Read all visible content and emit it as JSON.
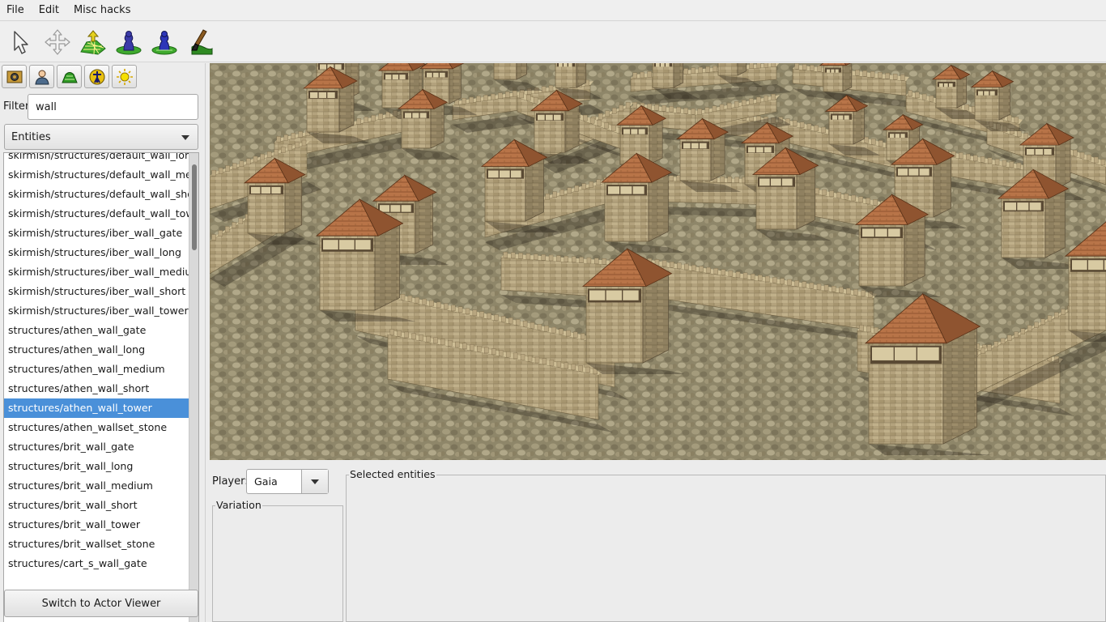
{
  "menu": {
    "items": [
      "File",
      "Edit",
      "Misc hacks"
    ]
  },
  "toolbar": {
    "tools": [
      {
        "icon": "select-arrow-icon"
      },
      {
        "icon": "move-cross-icon"
      },
      {
        "icon": "terrain-elevate-icon"
      },
      {
        "icon": "place-object-icon"
      },
      {
        "icon": "player-object-icon"
      },
      {
        "icon": "paint-brush-icon"
      }
    ]
  },
  "sections": {
    "buttons": [
      {
        "icon": "map-settings-icon"
      },
      {
        "icon": "player-settings-icon"
      },
      {
        "icon": "terrain-icon"
      },
      {
        "icon": "object-icon"
      },
      {
        "icon": "environment-sun-icon"
      }
    ]
  },
  "filter": {
    "label": "Filter",
    "value": "wall"
  },
  "type_combo": {
    "value": "Entities"
  },
  "entity_list": {
    "items": [
      "skirmish/structures/default_wall_long",
      "skirmish/structures/default_wall_medium",
      "skirmish/structures/default_wall_short",
      "skirmish/structures/default_wall_tower",
      "skirmish/structures/iber_wall_gate",
      "skirmish/structures/iber_wall_long",
      "skirmish/structures/iber_wall_medium",
      "skirmish/structures/iber_wall_short",
      "skirmish/structures/iber_wall_tower",
      "structures/athen_wall_gate",
      "structures/athen_wall_long",
      "structures/athen_wall_medium",
      "structures/athen_wall_short",
      "structures/athen_wall_tower",
      "structures/athen_wallset_stone",
      "structures/brit_wall_gate",
      "structures/brit_wall_long",
      "structures/brit_wall_medium",
      "structures/brit_wall_short",
      "structures/brit_wall_tower",
      "structures/brit_wallset_stone",
      "structures/cart_s_wall_gate"
    ],
    "selected": "structures/athen_wall_tower"
  },
  "switch_button": {
    "label": "Switch to Actor Viewer"
  },
  "bottom": {
    "player_label": "Player:",
    "player_value": "Gaia",
    "variation_title": "Variation",
    "selected_title": "Selected entities"
  },
  "colors": {
    "selection": "#4a90d9",
    "panel_bg": "#ececec",
    "roof": "#b0703e",
    "wall": "#b8a680",
    "ground": "#8a8268"
  }
}
